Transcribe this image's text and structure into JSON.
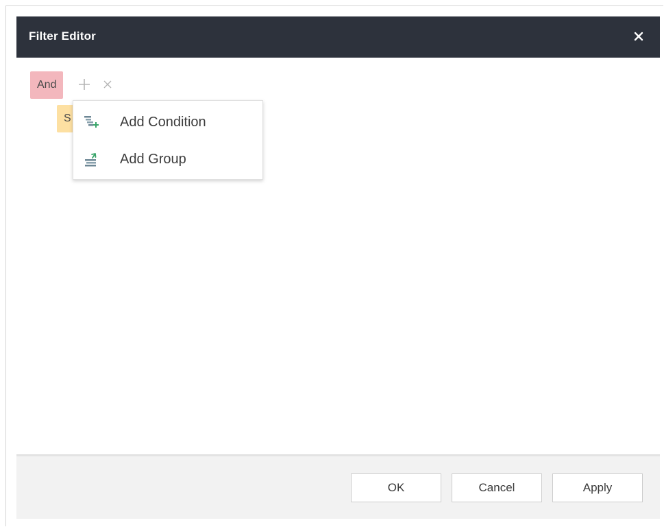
{
  "dialog": {
    "title": "Filter Editor",
    "close_icon": "close-icon"
  },
  "filter": {
    "group_operator": "And",
    "add_icon": "plus-icon",
    "remove_icon": "remove-icon",
    "condition_chip_text": "S"
  },
  "context_menu": {
    "items": [
      {
        "label": "Add Condition",
        "icon": "add-condition-icon"
      },
      {
        "label": "Add Group",
        "icon": "add-group-icon"
      }
    ]
  },
  "footer": {
    "ok_label": "OK",
    "cancel_label": "Cancel",
    "apply_label": "Apply"
  },
  "colors": {
    "titlebar": "#2d323c",
    "group_operator_bg": "#f3b7bd",
    "condition_bg": "#fde0a2",
    "footer_bg": "#f2f2f2"
  }
}
